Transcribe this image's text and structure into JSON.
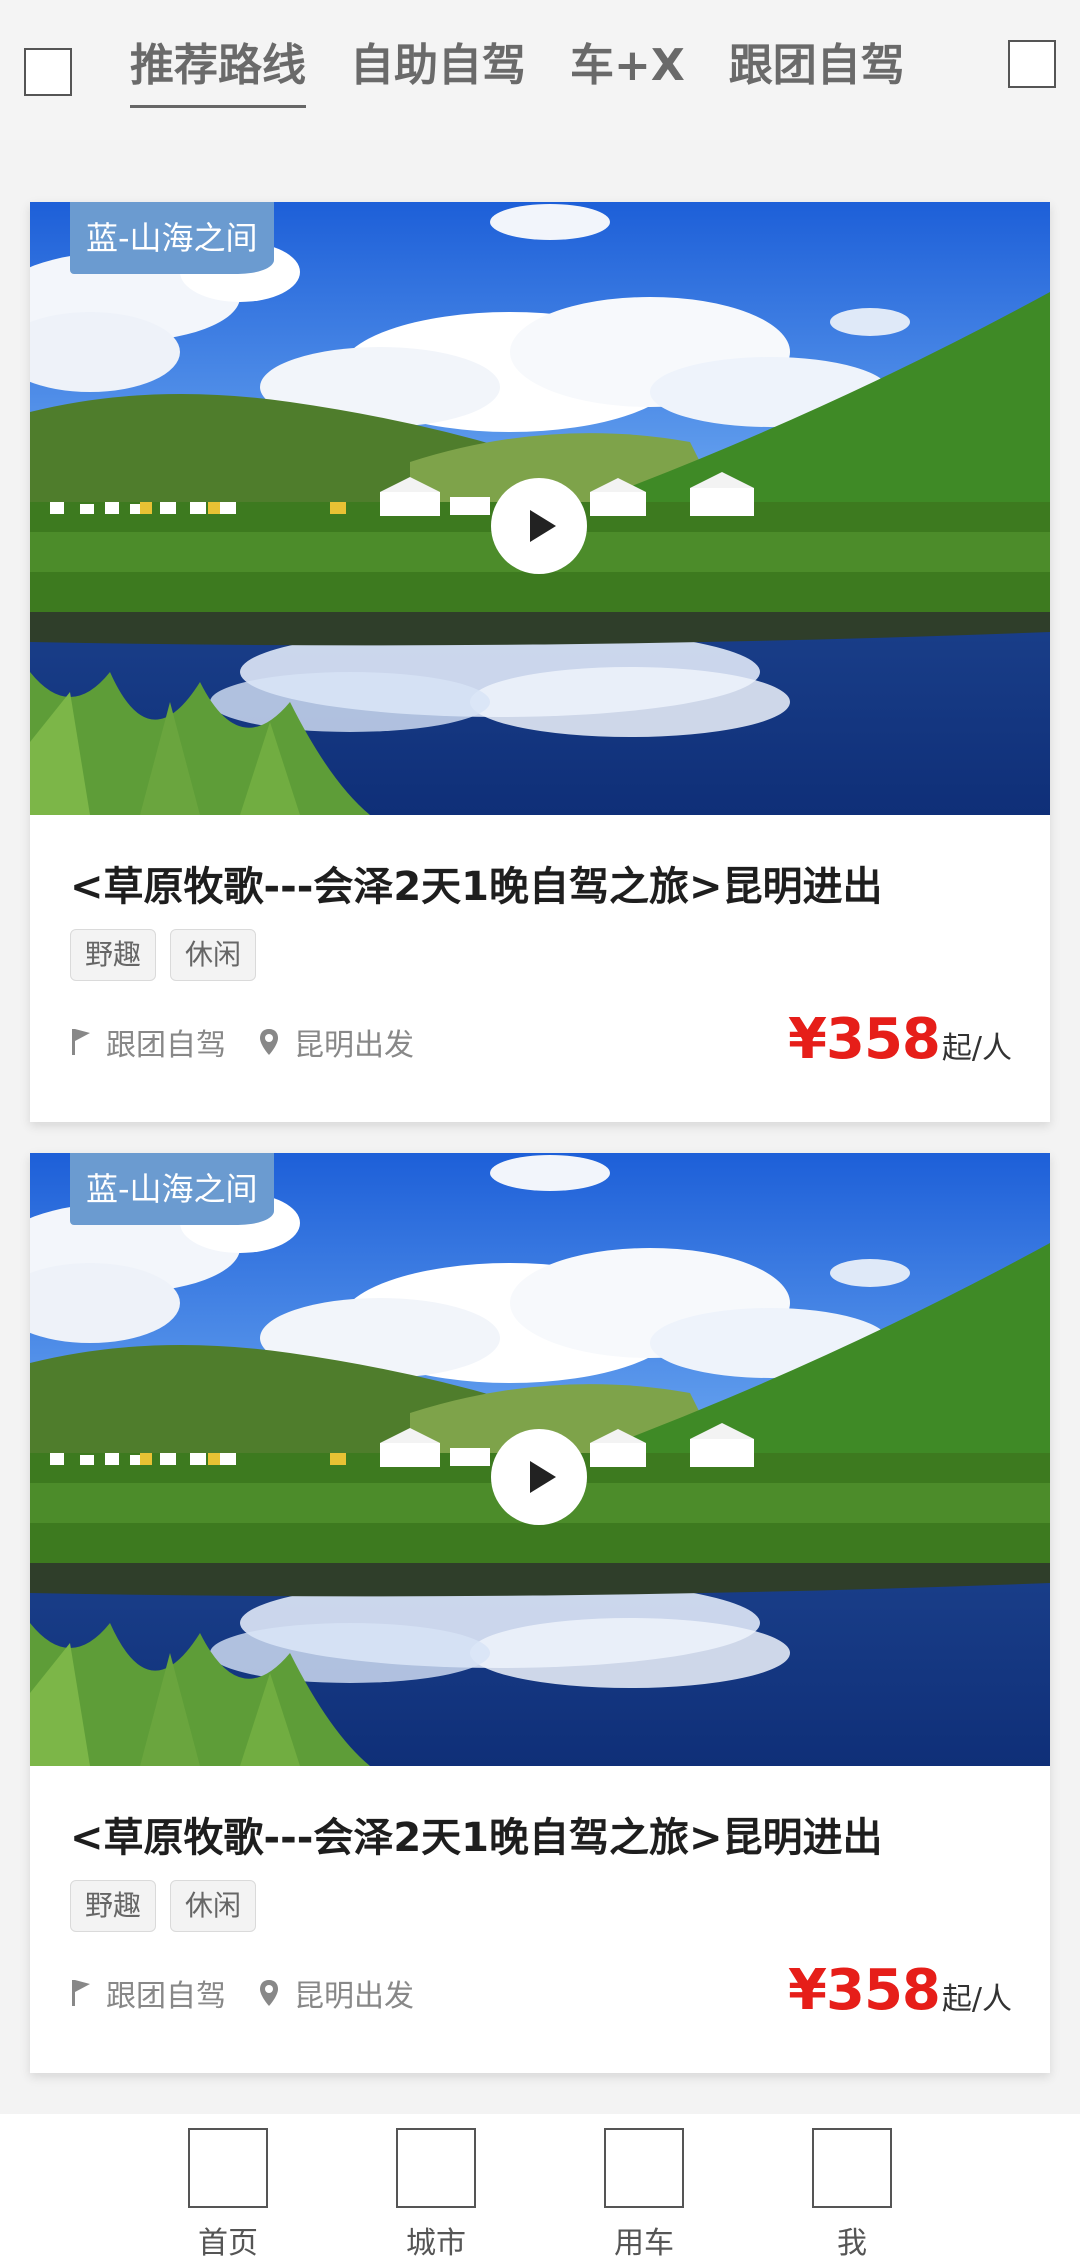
{
  "header": {
    "tabs": [
      {
        "label": "推荐路线",
        "active": true
      },
      {
        "label": "自助自驾",
        "active": false
      },
      {
        "label": "车+X",
        "active": false
      },
      {
        "label": "跟团自驾",
        "active": false
      }
    ]
  },
  "cards": [
    {
      "ribbon": "蓝-山海之间",
      "title": "<草原牧歌---会泽2天1晚自驾之旅>昆明进出",
      "chips": [
        "野趣",
        "休闲"
      ],
      "meta": {
        "type": "跟团自驾",
        "departure": "昆明出发"
      },
      "price": {
        "amount": "¥358",
        "unit": "起/人"
      }
    },
    {
      "ribbon": "蓝-山海之间",
      "title": "<草原牧歌---会泽2天1晚自驾之旅>昆明进出",
      "chips": [
        "野趣",
        "休闲"
      ],
      "meta": {
        "type": "跟团自驾",
        "departure": "昆明出发"
      },
      "price": {
        "amount": "¥358",
        "unit": "起/人"
      }
    }
  ],
  "bottom_nav": [
    {
      "label": "首页"
    },
    {
      "label": "城市"
    },
    {
      "label": "用车"
    },
    {
      "label": "我"
    }
  ],
  "colors": {
    "price": "#e61e19",
    "ribbon": "#6b9bd0",
    "sky": "#1f63d6",
    "grass": "#3d7a1f"
  },
  "icons": {
    "meta_type": "flag-icon",
    "meta_departure": "location-pin-icon",
    "play": "play-icon"
  }
}
